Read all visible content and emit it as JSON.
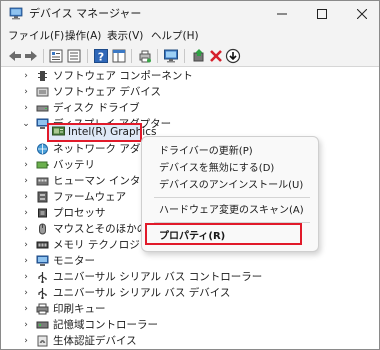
{
  "window": {
    "title": "デバイス マネージャー"
  },
  "menu": [
    {
      "label": "ファイル(F)"
    },
    {
      "label": "操作(A)"
    },
    {
      "label": "表示(V)"
    },
    {
      "label": "ヘルプ(H)"
    }
  ],
  "tree": {
    "items": [
      {
        "label": "ソフトウェア コンポーネント",
        "expanded": false
      },
      {
        "label": "ソフトウェア デバイス",
        "expanded": false
      },
      {
        "label": "ディスク ドライブ",
        "expanded": false
      },
      {
        "label": "ディスプレイ アダプター",
        "expanded": true
      },
      {
        "label": "Intel(R) Graphics",
        "child": true,
        "selected": true
      },
      {
        "label": "ネットワーク アダプター",
        "expanded": false
      },
      {
        "label": "バッテリ",
        "expanded": false
      },
      {
        "label": "ヒューマン インターフェイス",
        "expanded": false
      },
      {
        "label": "ファームウェア",
        "expanded": false
      },
      {
        "label": "プロセッサ",
        "expanded": false
      },
      {
        "label": "マウスとそのほかのポイン",
        "expanded": false
      },
      {
        "label": "メモリ テクノロジ デバイス",
        "expanded": false
      },
      {
        "label": "モニター",
        "expanded": false
      },
      {
        "label": "ユニバーサル シリアル バス コントローラー",
        "expanded": false
      },
      {
        "label": "ユニバーサル シリアル バス デバイス",
        "expanded": false
      },
      {
        "label": "印刷キュー",
        "expanded": false
      },
      {
        "label": "記憶域コントローラー",
        "expanded": false
      },
      {
        "label": "生体認証デバイス",
        "expanded": false
      }
    ]
  },
  "context_menu": {
    "items": [
      {
        "label": "ドライバーの更新(P)"
      },
      {
        "label": "デバイスを無効にする(D)"
      },
      {
        "label": "デバイスのアンインストール(U)"
      },
      {
        "label": "ハードウェア変更のスキャン(A)"
      },
      {
        "label": "プロパティ(R)",
        "bold": true
      }
    ]
  },
  "colors": {
    "highlight": "#e11a2a",
    "selection": "#dfe9f7",
    "accent": "#1f6fd1"
  }
}
